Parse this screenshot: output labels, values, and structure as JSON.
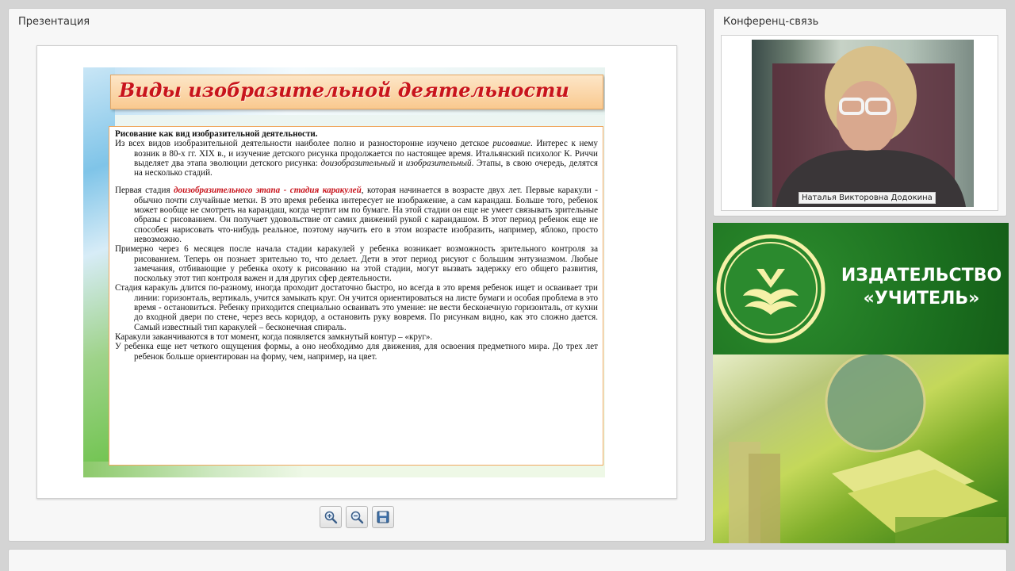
{
  "presentation": {
    "title": "Презентация",
    "slide": {
      "title": "Виды изобразительной деятельности",
      "heading": "Рисование как вид изобразительной деятельности.",
      "p1_a": "Из всех видов изобразительной деятельности наиболее полно и разносторонне изучено детское ",
      "p1_b": "рисование",
      "p1_c": ". Интерес к нему возник в 80-х гг. XIX в., и изучение детского рисунка продолжается по настоящее время. Итальянский психолог К. Риччи выделяет два этапа эволюции детского рисунка: ",
      "p1_d": "доизобразительный",
      "p1_e": " и ",
      "p1_f": "изобразительный",
      "p1_g": ". Этапы, в свою очередь, делятся на несколько стадий.",
      "p2_a": "Первая стадия ",
      "p2_b": "доизобразительного этапа - стадия каракулей",
      "p2_c": ", которая начинается в возрасте двух лет. Первые каракули - обычно почти случайные метки. В это время ребенка интересует не изображение, а сам карандаш. Больше того, ребенок может вообще не смотреть на карандаш, когда чертит им по бумаге. На этой стадии он еще не умеет связывать зрительные образы с рисованием. Он получает удовольствие от самих движений рукой с карандашом. В этот период ребенок еще не способен нарисовать что-нибудь реальное, поэтому научить его в этом возрасте изобразить, например, яблоко, просто невозможно.",
      "p3": "Примерно через 6 месяцев после начала стадии каракулей у ребенка возникает возможность зрительного контроля за рисованием. Теперь он познает зрительно то, что делает. Дети в этот период рисуют с большим энтузиазмом. Любые замечания, отбивающие у ребенка охоту к рисованию на этой стадии, могут вызвать задержку его общего развития, поскольку этот тип контроля важен и для других сфер деятельности.",
      "p4": "Стадия каракуль длится по-разному, иногда проходит достаточно быстро, но всегда в это время ребенок ищет и осваивает три линии: горизонталь, вертикаль, учится замыкать круг. Он учится ориентироваться на листе бумаги и особая проблема в это время - остановиться. Ребенку приходится специально осваивать это умение: не вести бесконечную горизонталь, от кухни до входной двери по стене, через весь коридор, а остановить руку вовремя. По рисункам видно, как это сложно дается. Самый известный тип каракулей – бесконечная спираль.",
      "p5": "Каракули заканчиваются в тот момент, когда появляется замкнутый контур – «круг».",
      "p6": "У ребенка еще нет четкого ощущения формы, а оно необходимо для движения, для освоения предметного мира. До трех лет ребенок больше ориентирован на форму, чем, например, на цвет."
    },
    "toolbar": {
      "zoom_in_icon": "zoom-in-icon",
      "zoom_out_icon": "zoom-out-icon",
      "save_icon": "save-icon"
    }
  },
  "conference": {
    "title": "Конференц-связь",
    "participant_name": "Наталья Викторовна Додокина"
  },
  "banner": {
    "line1": "ИЗДАТЕЛЬСТВО",
    "line2": "«УЧИТЕЛЬ»"
  },
  "colors": {
    "accent_red": "#c8141c",
    "banner_green": "#1f7a22",
    "slide_border": "#f0a860"
  }
}
